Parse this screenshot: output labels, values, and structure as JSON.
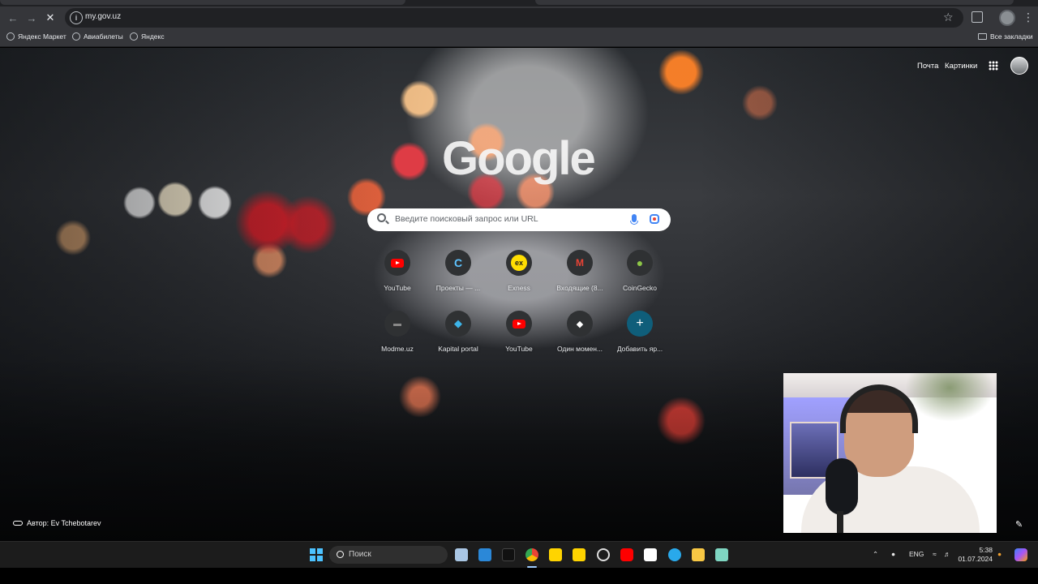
{
  "browser": {
    "url": "my.gov.uz",
    "bookmarks": [
      "Яндекс Маркет",
      "Авиабилеты",
      "Яндекс"
    ],
    "all_bookmarks_label": "Все закладки"
  },
  "ntp": {
    "top_links": [
      "Почта",
      "Картинки"
    ],
    "logo_text": "Google",
    "search_placeholder": "Введите поисковый запрос или URL",
    "shortcuts": [
      {
        "label": "YouTube",
        "icon": "youtube-icon",
        "glyph": ""
      },
      {
        "label": "Проекты — ...",
        "icon": "c-app-icon",
        "glyph": "C"
      },
      {
        "label": "Exness",
        "icon": "exness-icon",
        "glyph": "ex"
      },
      {
        "label": "Входящие (8...",
        "icon": "gmail-icon",
        "glyph": "M"
      },
      {
        "label": "CoinGecko",
        "icon": "coingecko-icon",
        "glyph": "●"
      },
      {
        "label": "Modme.uz",
        "icon": "modme-icon",
        "glyph": "▬"
      },
      {
        "label": "Kapital portal",
        "icon": "kapital-icon",
        "glyph": "◆"
      },
      {
        "label": "YouTube",
        "icon": "youtube-icon",
        "glyph": ""
      },
      {
        "label": "Один момен...",
        "icon": "diamond-app-icon",
        "glyph": "◆"
      },
      {
        "label": "Добавить яр...",
        "icon": "plus-icon",
        "glyph": "+"
      }
    ],
    "author_label": "Автор: Ev Tchebotarev"
  },
  "taskbar": {
    "search_label": "Поиск",
    "language": "ENG",
    "time": "5:38",
    "date": "01.07.2024"
  },
  "colors": {
    "chrome_bg": "#35363a",
    "omnibox_bg": "#202124",
    "taskbar_bg": "#1c1c1c",
    "accent_blue": "#4285f4"
  }
}
